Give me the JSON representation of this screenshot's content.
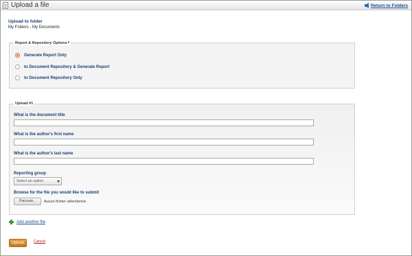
{
  "window": {
    "title": "Upload a file",
    "return_link": "Return to Folders"
  },
  "header": {
    "heading": "Upload to folder",
    "breadcrumb": "My Folders - My Documents"
  },
  "report_options": {
    "legend": "Report & Repository Options",
    "required_marker": "•",
    "options": [
      {
        "label": "Generate Report Only",
        "checked": true
      },
      {
        "label": "to Document Repository & Generate Report",
        "checked": false
      },
      {
        "label": "to Document Repository Only",
        "checked": false
      }
    ]
  },
  "upload_section": {
    "legend": "Upload #1",
    "title_label": "What is the document title",
    "title_value": "",
    "first_name_label": "What is the author's first name",
    "first_name_value": "",
    "last_name_label": "What is the author's last name",
    "last_name_value": "",
    "reporting_group_label": "Reporting group",
    "reporting_group_value": "Select an option",
    "browse_label": "Browse for the file you would like to submit",
    "browse_button": "Parcourir...",
    "file_status": "Aucun fichier sélectionné."
  },
  "actions": {
    "add_another": "Add another file",
    "upload": "Upload",
    "cancel": "Cancel"
  },
  "colors": {
    "accent_orange": "#e07030",
    "link_blue": "#1a4f8f",
    "label_navy": "#1a3f73",
    "cancel_red": "#b01818",
    "add_green": "#3a9a3a"
  }
}
